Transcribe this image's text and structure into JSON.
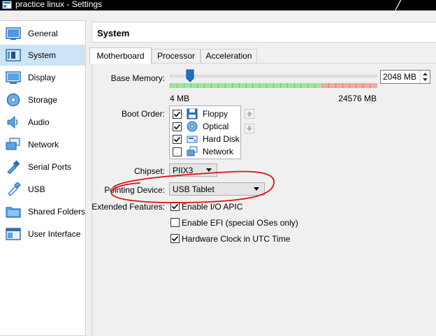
{
  "window": {
    "title": "practice linux - Settings"
  },
  "sidebar": {
    "items": [
      {
        "label": "General",
        "icon": "general-icon"
      },
      {
        "label": "System",
        "icon": "system-icon",
        "selected": true
      },
      {
        "label": "Display",
        "icon": "display-icon"
      },
      {
        "label": "Storage",
        "icon": "storage-icon"
      },
      {
        "label": "Audio",
        "icon": "audio-icon"
      },
      {
        "label": "Network",
        "icon": "network-icon"
      },
      {
        "label": "Serial Ports",
        "icon": "serial-ports-icon"
      },
      {
        "label": "USB",
        "icon": "usb-icon"
      },
      {
        "label": "Shared Folders",
        "icon": "shared-folders-icon"
      },
      {
        "label": "User Interface",
        "icon": "user-interface-icon"
      }
    ]
  },
  "header": {
    "title": "System"
  },
  "tabs": [
    {
      "label": "Motherboard",
      "active": true
    },
    {
      "label": "Processor"
    },
    {
      "label": "Acceleration"
    }
  ],
  "motherboard": {
    "base_memory": {
      "label": "Base Memory:",
      "value": "2048 MB",
      "min_label": "4 MB",
      "max_label": "24576 MB",
      "value_mb": 2048,
      "min_mb": 4,
      "max_mb": 24576
    },
    "boot_order": {
      "label": "Boot Order:",
      "items": [
        {
          "label": "Floppy",
          "checked": true,
          "icon": "floppy-icon"
        },
        {
          "label": "Optical",
          "checked": true,
          "icon": "optical-disc-icon"
        },
        {
          "label": "Hard Disk",
          "checked": true,
          "icon": "hard-disk-icon"
        },
        {
          "label": "Network",
          "checked": false,
          "icon": "network-icon"
        }
      ]
    },
    "chipset": {
      "label": "Chipset:",
      "value": "PIIX3"
    },
    "pointing_device": {
      "label": "Pointing Device:",
      "value": "USB Tablet"
    },
    "extended_features": {
      "label": "Extended Features:",
      "items": [
        {
          "label": "Enable I/O APIC",
          "checked": true
        },
        {
          "label": "Enable EFI (special OSes only)",
          "checked": false
        },
        {
          "label": "Hardware Clock in UTC Time",
          "checked": true
        }
      ]
    }
  },
  "colors": {
    "selection": "#cce4f7",
    "annotation": "#e01010",
    "scale_green": "#9ee59e",
    "scale_orange": "#f7d38d",
    "scale_red": "#f5a7a2"
  }
}
